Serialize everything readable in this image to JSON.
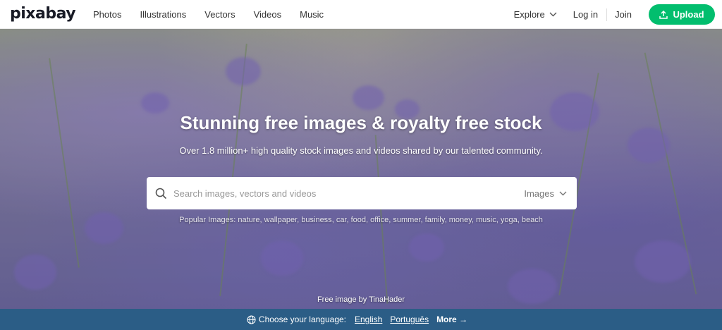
{
  "header": {
    "logo": "pixabay",
    "nav": [
      "Photos",
      "Illustrations",
      "Vectors",
      "Videos",
      "Music"
    ],
    "explore_label": "Explore",
    "login_label": "Log in",
    "join_label": "Join",
    "upload_label": "Upload"
  },
  "hero": {
    "title": "Stunning free images & royalty free stock",
    "subtitle": "Over 1.8 million+ high quality stock images and videos shared by our talented community.",
    "search_placeholder": "Search images, vectors and videos",
    "search_type": "Images",
    "popular_label": "Popular Images:",
    "popular_terms": [
      "nature",
      "wallpaper",
      "business",
      "car",
      "food",
      "office",
      "summer",
      "family",
      "money",
      "music",
      "yoga",
      "beach"
    ],
    "credit": "Free image by TinaHader"
  },
  "language_bar": {
    "choose_label": "Choose your language:",
    "languages": [
      "English",
      "Português"
    ],
    "more_label": "More →"
  },
  "colors": {
    "accent_green": "#02be6e",
    "lang_bar_blue": "#2b5d86"
  }
}
